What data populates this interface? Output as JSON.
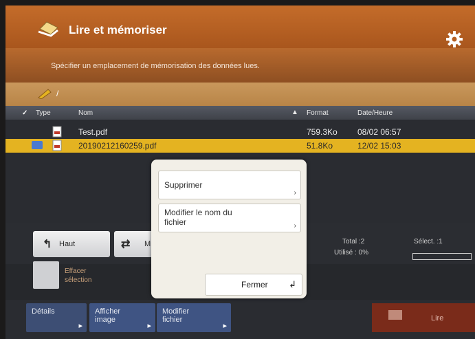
{
  "header": {
    "title": "Lire et mémoriser",
    "app_icon": "scanner-doc-icon",
    "settings_icon": "gear-icon"
  },
  "info": {
    "text": "Spécifier un emplacement de mémorisation des données lues."
  },
  "path": {
    "icon": "pencil-icon",
    "text": "/"
  },
  "columns": {
    "type": "Type",
    "name": "Nom",
    "sort_icon": "sort-up-icon",
    "format": "Format",
    "date": "Date/Heure"
  },
  "files": [
    {
      "name": "Test.pdf",
      "size": "759.3Ko",
      "date": "08/02  06:57",
      "selected": false
    },
    {
      "name": "20190212160259.pdf",
      "size": "51.8Ko",
      "date": "12/02  15:03",
      "selected": true
    }
  ],
  "nav": {
    "up_label": "Haut",
    "move_label": "M"
  },
  "status": {
    "total": "Total :2",
    "used": "Utilisé : 0%",
    "selected": "Sélect. :1"
  },
  "clear": {
    "label": "Effacer sélection"
  },
  "tabs": {
    "details": "Détails",
    "show_image": "Afficher image",
    "modify_file": "Modifier fichier",
    "read": "Lire"
  },
  "dialog": {
    "delete": "Supprimer",
    "rename": "Modifier le nom du fichier",
    "close": "Fermer"
  },
  "colors": {
    "header": "#b55f22",
    "selected_row": "#e4b321",
    "tab_blue": "#3f5483"
  }
}
